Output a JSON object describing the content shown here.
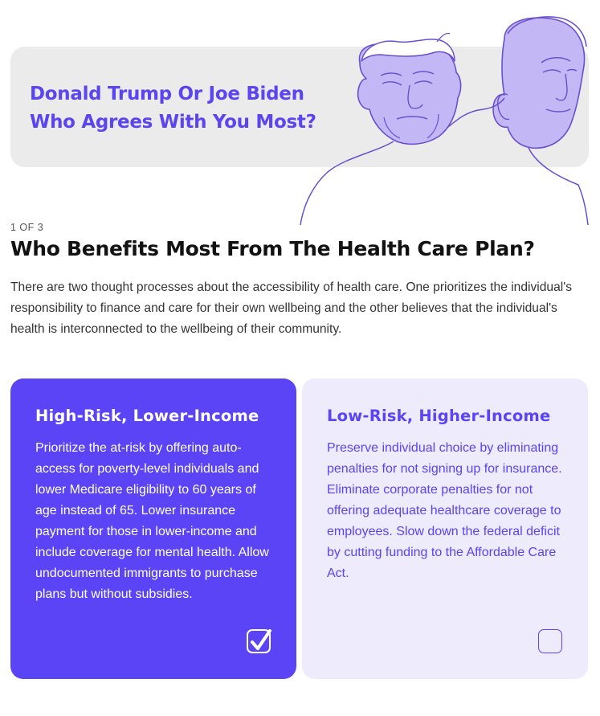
{
  "colors": {
    "accent": "#5a44f5",
    "accent_light": "#eeebfc",
    "hero_bg": "#ebebeb",
    "illustration_fill": "#c3b8f5",
    "illustration_stroke": "#6a4fd0"
  },
  "hero": {
    "title_line1": "Donald Trump Or Joe Biden",
    "title_line2": "Who Agrees With You Most?",
    "illustration_icon": "candidate-portraits-illustration"
  },
  "question": {
    "counter": "1 OF 3",
    "title": "Who Benefits Most From The Health Care Plan?",
    "intro": "There are two thought processes about the accessibility of health care. One prioritizes the individual's responsibility to finance and care for their own wellbeing and the other believes that the individual's health is interconnected to the wellbeing of their community."
  },
  "options": [
    {
      "title": "High-Risk, Lower-Income",
      "body": "Prioritize the at-risk by offering auto-access for poverty-level individuals and lower Medicare eligibility to 60 years of age instead of 65. Lower insurance payment for those in lower-income and include coverage for mental health. Allow undocumented immigrants to purchase plans but without subsidies.",
      "selected": true,
      "icon": "checkbox-checked-icon"
    },
    {
      "title": "Low-Risk, Higher-Income",
      "body": "Preserve individual choice by eliminating penalties for not signing up for insurance. Eliminate corporate penalties for not offering adequate healthcare coverage to employees. Slow down the federal deficit by cutting funding to the Affordable Care Act.",
      "selected": false,
      "icon": "checkbox-empty-icon"
    }
  ]
}
